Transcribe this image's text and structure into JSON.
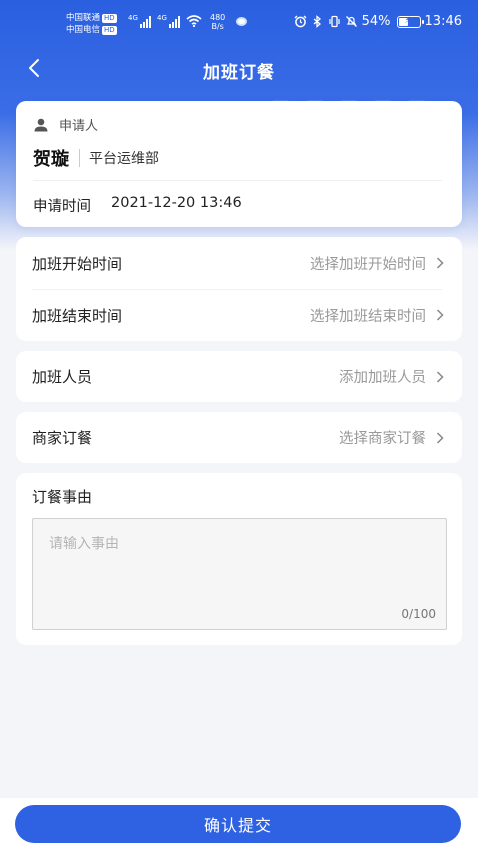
{
  "status_bar": {
    "carrier1": "中国联通",
    "carrier2": "中国电信",
    "hd_badge": "HD",
    "signal_gen1": "4G",
    "signal_gen2": "4G",
    "net_speed_value": "480",
    "net_speed_unit": "B/s",
    "battery_percent": "54%",
    "battery_level": 0.54,
    "time": "13:46",
    "icons": [
      "alarm-icon",
      "bluetooth-icon",
      "vibrate-icon",
      "mute-icon",
      "battery-icon",
      "wifi-icon"
    ]
  },
  "nav": {
    "title": "加班订餐",
    "back_icon": "chevron-left-icon"
  },
  "applicant": {
    "label": "申请人",
    "name": "贺璇",
    "department": "平台运维部",
    "time_label": "申请时间",
    "time_value": "2021-12-20 13:46"
  },
  "form": {
    "start_time": {
      "label": "加班开始时间",
      "placeholder": "选择加班开始时间"
    },
    "end_time": {
      "label": "加班结束时间",
      "placeholder": "选择加班结束时间"
    },
    "staff": {
      "label": "加班人员",
      "placeholder": "添加加班人员"
    },
    "merchant": {
      "label": "商家订餐",
      "placeholder": "选择商家订餐"
    },
    "reason": {
      "label": "订餐事由",
      "placeholder": "请输入事由",
      "value": "",
      "counter": "0/100"
    }
  },
  "submit": {
    "label": "确认提交"
  },
  "colors": {
    "primary": "#2e62e2",
    "background": "#f4f5f9",
    "placeholder": "#999999"
  }
}
